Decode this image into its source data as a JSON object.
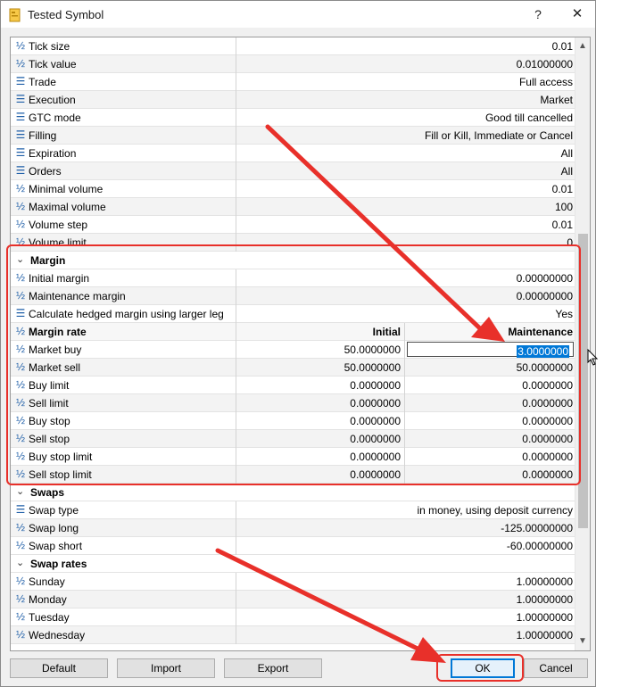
{
  "window": {
    "title": "Tested Symbol",
    "help_label": "?",
    "close_label": "✕"
  },
  "rows": [
    {
      "kind": "prop",
      "icon": "half-icon",
      "label": "Tick size",
      "value": "0.01"
    },
    {
      "kind": "prop",
      "icon": "half-icon",
      "label": "Tick value",
      "value": "0.01000000"
    },
    {
      "kind": "prop",
      "icon": "list-icon",
      "label": "Trade",
      "value": "Full access"
    },
    {
      "kind": "prop",
      "icon": "list-icon",
      "label": "Execution",
      "value": "Market"
    },
    {
      "kind": "prop",
      "icon": "list-icon",
      "label": "GTC mode",
      "value": "Good till cancelled"
    },
    {
      "kind": "prop",
      "icon": "list-icon",
      "label": "Filling",
      "value": "Fill or Kill, Immediate or Cancel"
    },
    {
      "kind": "prop",
      "icon": "list-icon",
      "label": "Expiration",
      "value": "All"
    },
    {
      "kind": "prop",
      "icon": "list-icon",
      "label": "Orders",
      "value": "All"
    },
    {
      "kind": "prop",
      "icon": "half-icon",
      "label": "Minimal volume",
      "value": "0.01"
    },
    {
      "kind": "prop",
      "icon": "half-icon",
      "label": "Maximal volume",
      "value": "100"
    },
    {
      "kind": "prop",
      "icon": "half-icon",
      "label": "Volume step",
      "value": "0.01"
    },
    {
      "kind": "prop",
      "icon": "half-icon",
      "label": "Volume limit",
      "value": "0"
    }
  ],
  "margin": {
    "section_label": "Margin",
    "rows": [
      {
        "icon": "half-icon",
        "label": "Initial margin",
        "value": "0.00000000"
      },
      {
        "icon": "half-icon",
        "label": "Maintenance margin",
        "value": "0.00000000"
      },
      {
        "icon": "list-icon",
        "label": "Calculate hedged margin using larger leg",
        "value": "Yes"
      }
    ],
    "rate_header": {
      "label": "Margin rate",
      "col1": "Initial",
      "col2": "Maintenance"
    },
    "rates": [
      {
        "label": "Market buy",
        "initial": "50.0000000",
        "maintenance": "3.0000000"
      },
      {
        "label": "Market sell",
        "initial": "50.0000000",
        "maintenance": "50.0000000"
      },
      {
        "label": "Buy limit",
        "initial": "0.0000000",
        "maintenance": "0.0000000"
      },
      {
        "label": "Sell limit",
        "initial": "0.0000000",
        "maintenance": "0.0000000"
      },
      {
        "label": "Buy stop",
        "initial": "0.0000000",
        "maintenance": "0.0000000"
      },
      {
        "label": "Sell stop",
        "initial": "0.0000000",
        "maintenance": "0.0000000"
      },
      {
        "label": "Buy stop limit",
        "initial": "0.0000000",
        "maintenance": "0.0000000"
      },
      {
        "label": "Sell stop limit",
        "initial": "0.0000000",
        "maintenance": "0.0000000"
      }
    ]
  },
  "swaps": {
    "section_label": "Swaps",
    "rows": [
      {
        "icon": "list-icon",
        "label": "Swap type",
        "value": "in money, using deposit currency"
      },
      {
        "icon": "half-icon",
        "label": "Swap long",
        "value": "-125.00000000"
      },
      {
        "icon": "half-icon",
        "label": "Swap short",
        "value": "-60.00000000"
      }
    ]
  },
  "swap_rates": {
    "section_label": "Swap rates",
    "rows": [
      {
        "icon": "half-icon",
        "label": "Sunday",
        "value": "1.00000000"
      },
      {
        "icon": "half-icon",
        "label": "Monday",
        "value": "1.00000000"
      },
      {
        "icon": "half-icon",
        "label": "Tuesday",
        "value": "1.00000000"
      },
      {
        "icon": "half-icon",
        "label": "Wednesday",
        "value": "1.00000000"
      }
    ]
  },
  "buttons": {
    "default": "Default",
    "import": "Import",
    "export": "Export",
    "ok": "OK",
    "cancel": "Cancel"
  },
  "colors": {
    "highlight": "#e8302a",
    "selection": "#0078d7",
    "icon": "#1f5fa8"
  }
}
